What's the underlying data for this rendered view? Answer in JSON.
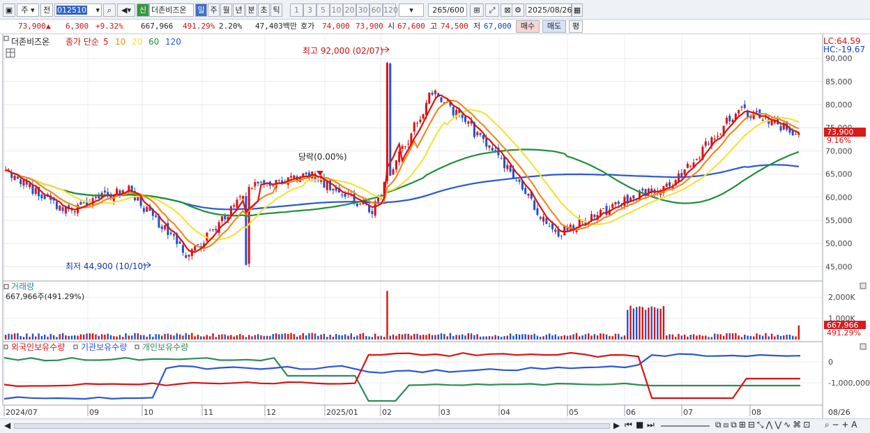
{
  "toolbar": {
    "period_unit": "주",
    "prev_label": "전",
    "stock_code": "012510",
    "badge_new": "신",
    "stock_name": "더존비즈온",
    "period_buttons": [
      "일",
      "주",
      "월",
      "년",
      "분",
      "초",
      "틱"
    ],
    "active_period": "일",
    "interval_buttons": [
      "1",
      "3",
      "5",
      "10",
      "20",
      "30",
      "60",
      "120"
    ],
    "count_display": "265/600",
    "date": "2025/08/26"
  },
  "quote": {
    "price": "73,900",
    "change": "6,300",
    "change_pct": "+9.32%",
    "volume": "667,966",
    "volume_ratio": "491.29%",
    "turnover_pct": "2.20%",
    "amount": "47,403백만",
    "bid_label": "호가",
    "bid1": "74,000",
    "bid2": "73,900",
    "open_label": "시",
    "open": "67,600",
    "high_label": "고",
    "high": "74,500",
    "low_label": "저",
    "low": "67,000",
    "buy_label": "매수",
    "sell_label": "매도",
    "avg_label": "평"
  },
  "colors": {
    "candle_up": "#dd1111",
    "candle_down": "#1f52d0",
    "ma5": "#dd1111",
    "ma10": "#f18a1c",
    "ma20": "#f5e23c",
    "ma60": "#1e8f35",
    "ma120": "#2b55d8",
    "foreign": "#dd1111",
    "institution": "#2b55d8",
    "individual": "#2e8b57"
  },
  "price_panel": {
    "stock_label": "더존비즈온",
    "legend_prefix": "종가 단순",
    "ma_periods": [
      "5",
      "10",
      "20",
      "60",
      "120"
    ],
    "lc": "LC:64.59",
    "hc": "HC:-19.67",
    "y_ticks": [
      "90,000",
      "85,000",
      "80,000",
      "75,000",
      "70,000",
      "65,000",
      "60,000",
      "55,000",
      "50,000",
      "45,000"
    ],
    "current_price_tag": "73,900",
    "current_pct_tag": "9.16%",
    "high_note": "최고 92,000 (02/07)",
    "low_note": "최저 44,900 (10/10)",
    "limit_note": "당락(0.00%)"
  },
  "volume_panel": {
    "title": "거래량",
    "value": "667,966주(491.29%)",
    "y_ticks": [
      "2,000K",
      "1,000K"
    ],
    "current_tag": "667,966",
    "current_pct_tag": "491.29%"
  },
  "flow_panel": {
    "legend": [
      "외국인보유수량",
      "기관보유수량",
      "개인보유수량"
    ],
    "y_ticks": [
      "0",
      "-1,000,000"
    ]
  },
  "x_axis": {
    "labels": [
      "2024/07",
      "09",
      "10",
      "11",
      "12",
      "2025/01",
      "02",
      "03",
      "04",
      "05",
      "06",
      "07",
      "08"
    ],
    "end_label": "08/26"
  },
  "chart_data": {
    "type": "line",
    "ylim": [
      42500,
      94000
    ],
    "x": [
      "2024-07",
      "2024-08",
      "2024-09",
      "2024-10",
      "2024-11",
      "2024-12",
      "2025-01",
      "2025-02",
      "2025-03",
      "2025-04",
      "2025-05",
      "2025-06",
      "2025-07",
      "2025-08"
    ],
    "series": [
      {
        "name": "5",
        "values": [
          65500,
          57000,
          62000,
          47000,
          62000,
          65000,
          57000,
          83000,
          70000,
          52000,
          58000,
          64000,
          79000,
          73900
        ]
      },
      {
        "name": "120",
        "values": [
          56000,
          58500,
          60000,
          60500,
          60000,
          60000,
          60000,
          64000,
          64500,
          63500,
          63000,
          64000,
          66000,
          65500
        ]
      }
    ],
    "high_point": {
      "date": "2025-02-07",
      "value": 92000
    },
    "low_point": {
      "date": "2024-10-10",
      "value": 44900
    }
  }
}
